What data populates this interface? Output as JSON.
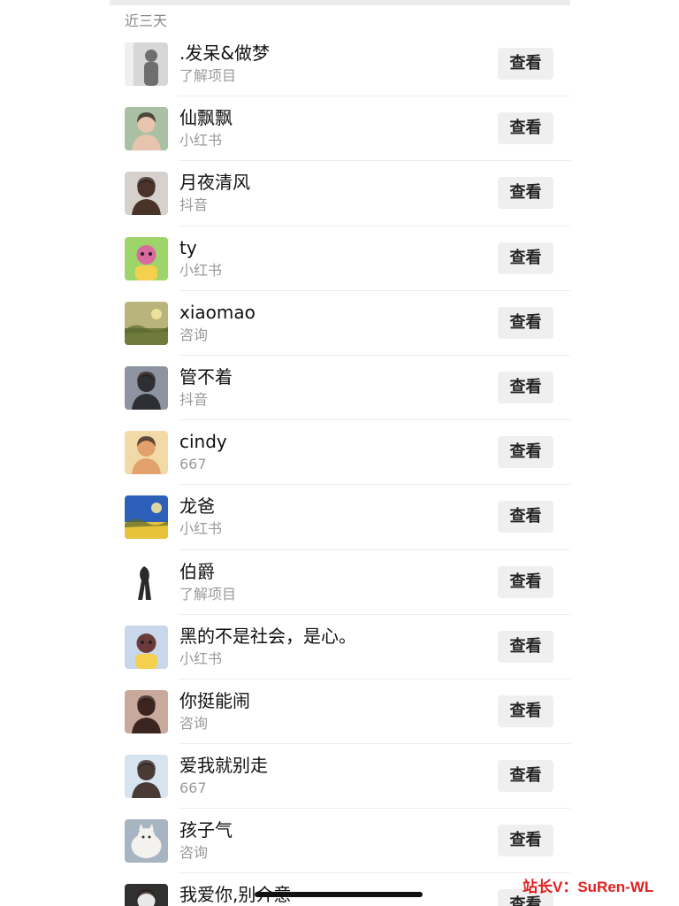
{
  "section": {
    "title": "近三天"
  },
  "contacts": [
    {
      "name": ".发呆&做梦",
      "subtitle": "了解项目",
      "button": "查看",
      "avatar": {
        "bg": "#d7d7d7",
        "fg": "#6e6e6e",
        "style": "person",
        "icon": "person-avatar"
      }
    },
    {
      "name": "仙飘飘",
      "subtitle": "小红书",
      "button": "查看",
      "avatar": {
        "bg": "#a9c0a4",
        "fg": "#e6c4ad",
        "style": "portrait",
        "icon": "portrait-avatar"
      }
    },
    {
      "name": "月夜清风",
      "subtitle": "抖音",
      "button": "查看",
      "avatar": {
        "bg": "#d6d1cc",
        "fg": "#4a3328",
        "style": "portrait",
        "icon": "portrait-avatar"
      }
    },
    {
      "name": "ty",
      "subtitle": "小红书",
      "button": "查看",
      "avatar": {
        "bg": "#9ed56a",
        "fg": "#d86aa0",
        "style": "cartoon",
        "icon": "cartoon-avatar"
      }
    },
    {
      "name": "xiaomao",
      "subtitle": "咨询",
      "button": "查看",
      "avatar": {
        "bg": "#b8b47c",
        "fg": "#6f7a3b",
        "style": "landscape",
        "icon": "landscape-avatar"
      }
    },
    {
      "name": "管不着",
      "subtitle": "抖音",
      "button": "查看",
      "avatar": {
        "bg": "#8d93a0",
        "fg": "#2d2f34",
        "style": "portrait",
        "icon": "portrait-avatar"
      }
    },
    {
      "name": "cindy",
      "subtitle": "667",
      "button": "查看",
      "avatar": {
        "bg": "#f2d9a8",
        "fg": "#e2a06a",
        "style": "portrait",
        "icon": "portrait-avatar"
      }
    },
    {
      "name": "龙爸",
      "subtitle": "小红书",
      "button": "查看",
      "avatar": {
        "bg": "#2c5fb8",
        "fg": "#e7c33b",
        "style": "landscape",
        "icon": "landscape-avatar"
      }
    },
    {
      "name": "伯爵",
      "subtitle": "了解项目",
      "button": "查看",
      "avatar": {
        "bg": "#ffffff",
        "fg": "#2a2a2a",
        "style": "sketch",
        "icon": "sketch-avatar"
      }
    },
    {
      "name": "黑的不是社会，是心。",
      "subtitle": "小红书",
      "button": "查看",
      "avatar": {
        "bg": "#c9d7ea",
        "fg": "#6b3b3b",
        "style": "cartoon",
        "icon": "cartoon-avatar"
      }
    },
    {
      "name": "你挺能闹",
      "subtitle": "咨询",
      "button": "查看",
      "avatar": {
        "bg": "#c9a99b",
        "fg": "#3b2520",
        "style": "portrait",
        "icon": "portrait-avatar"
      }
    },
    {
      "name": "爱我就别走",
      "subtitle": "667",
      "button": "查看",
      "avatar": {
        "bg": "#d7e3ef",
        "fg": "#4a3a35",
        "style": "portrait",
        "icon": "portrait-avatar"
      }
    },
    {
      "name": "孩子气",
      "subtitle": "咨询",
      "button": "查看",
      "avatar": {
        "bg": "#a7b4c2",
        "fg": "#f4f2ef",
        "style": "pet",
        "icon": "cat-avatar"
      }
    },
    {
      "name": "我爱你,别介意",
      "subtitle": "",
      "button": "查看",
      "avatar": {
        "bg": "#303030",
        "fg": "#e8e8e8",
        "style": "portrait",
        "icon": "portrait-avatar"
      }
    }
  ],
  "watermark": "站长V：SuRen-WL",
  "colors": {
    "accent_red": "#e02020",
    "button_bg": "#efefef",
    "divider": "#ececec"
  }
}
